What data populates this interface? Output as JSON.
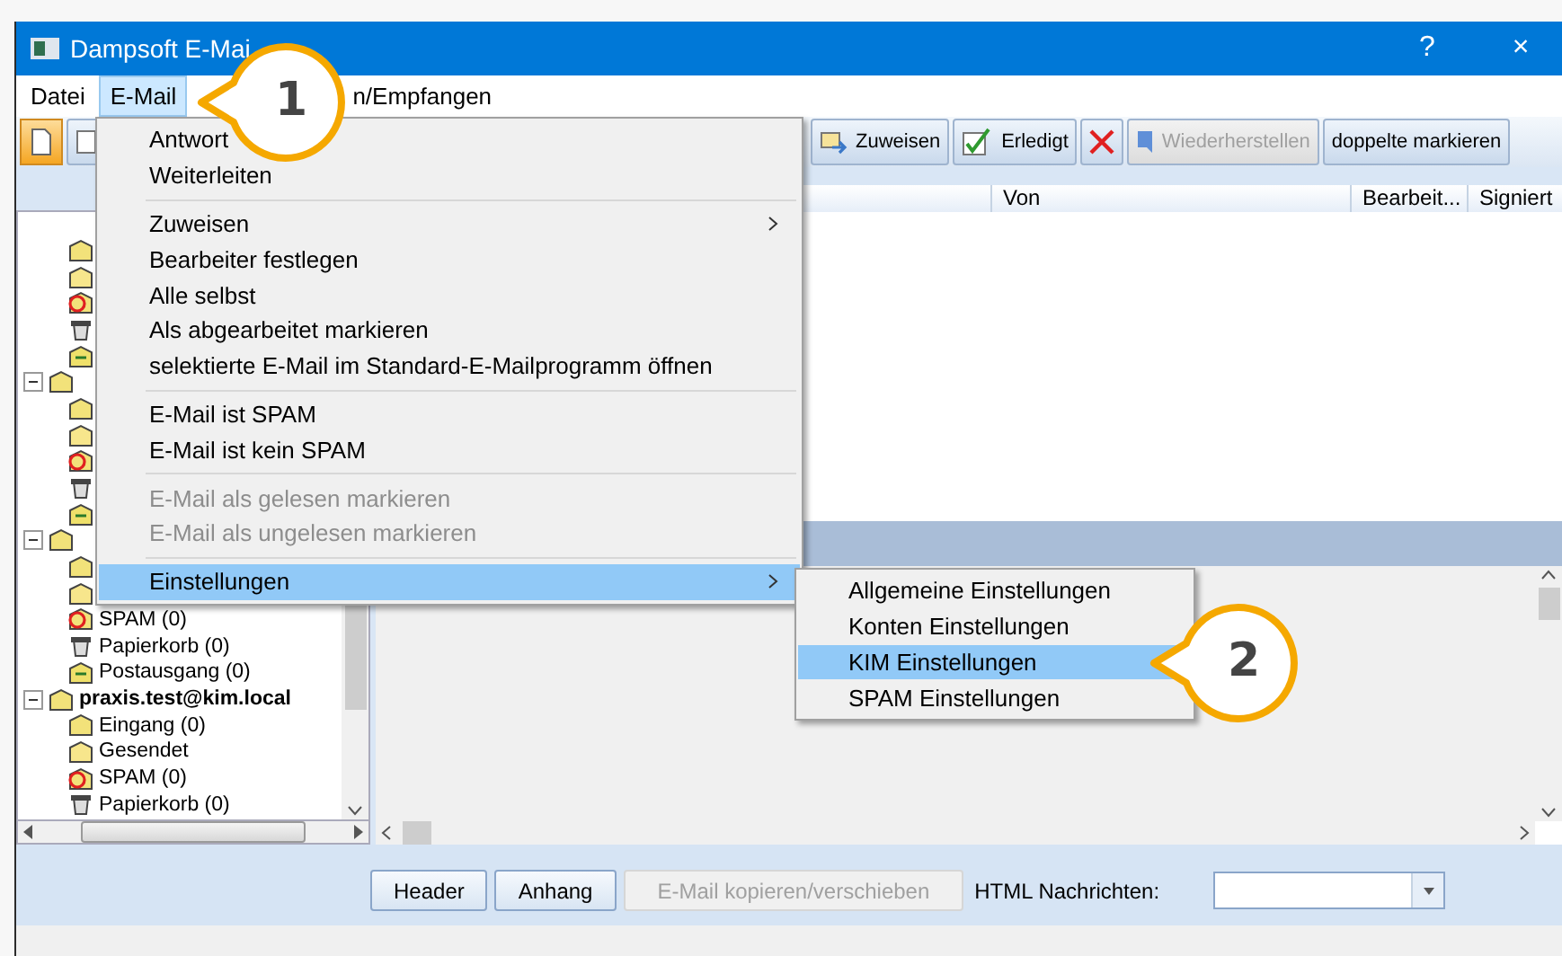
{
  "window": {
    "title": "Dampsoft E-Mai",
    "controls": [
      "?",
      "×"
    ]
  },
  "menu_bar": [
    {
      "label": "Datei",
      "selected": false
    },
    {
      "label": "E-Mail",
      "selected": true
    },
    {
      "label": "n/Empfangen",
      "selected": false
    }
  ],
  "toolbar": {
    "buttons": [
      {
        "kind": "assign",
        "label": "Zuweisen",
        "disabled": false
      },
      {
        "kind": "check",
        "label": "Erledigt",
        "disabled": false
      },
      {
        "kind": "delete",
        "disabled": false
      },
      {
        "kind": "restore",
        "label": "Wiederherstellen",
        "disabled": true
      },
      {
        "kind": "text",
        "label": "doppelte markieren",
        "disabled": false
      }
    ]
  },
  "columns": [
    {
      "label": "Von"
    },
    {
      "label": "Bearbeit..."
    },
    {
      "label": "Signiert"
    }
  ],
  "tree": [
    {
      "kind": "inbox"
    },
    {
      "kind": "sent"
    },
    {
      "kind": "spam"
    },
    {
      "kind": "trash"
    },
    {
      "kind": "outbox"
    },
    {
      "kind": "account",
      "expanded": true,
      "children": [
        {
          "kind": "inbox"
        },
        {
          "kind": "sent"
        },
        {
          "kind": "spam"
        },
        {
          "kind": "trash"
        },
        {
          "kind": "outbox"
        }
      ]
    },
    {
      "kind": "account",
      "expanded": true,
      "children": [
        {
          "kind": "inbox"
        },
        {
          "kind": "sent"
        },
        {
          "kind": "spam",
          "label": "SPAM (0)"
        },
        {
          "kind": "trash",
          "label": "Papierkorb (0)"
        },
        {
          "kind": "outbox",
          "label": "Postausgang (0)"
        }
      ]
    },
    {
      "kind": "account",
      "label": "praxis.test@kim.local",
      "expanded": true,
      "children": [
        {
          "kind": "inbox",
          "label": "Eingang (0)"
        },
        {
          "kind": "sent",
          "label": "Gesendet"
        },
        {
          "kind": "spam",
          "label": "SPAM (0)"
        },
        {
          "kind": "trash",
          "label": "Papierkorb (0)"
        }
      ]
    }
  ],
  "email_menu": [
    {
      "kind": "item",
      "label": "Antwort",
      "disabled": false,
      "selected": false
    },
    {
      "kind": "item",
      "label": "Weiterleiten",
      "disabled": false,
      "selected": false
    },
    {
      "kind": "separator"
    },
    {
      "kind": "submenu",
      "label": "Zuweisen",
      "disabled": false,
      "selected": false
    },
    {
      "kind": "item",
      "label": "Bearbeiter festlegen",
      "disabled": false,
      "selected": false
    },
    {
      "kind": "item",
      "label": "Alle selbst",
      "disabled": false,
      "selected": false
    },
    {
      "kind": "item",
      "label": "Als abgearbeitet markieren",
      "disabled": false,
      "selected": false
    },
    {
      "kind": "item",
      "label": "selektierte E-Mail im Standard-E-Mailprogramm öffnen",
      "disabled": false,
      "selected": false
    },
    {
      "kind": "separator"
    },
    {
      "kind": "item",
      "label": "E-Mail ist SPAM",
      "disabled": false,
      "selected": false
    },
    {
      "kind": "item",
      "label": "E-Mail ist kein SPAM",
      "disabled": false,
      "selected": false
    },
    {
      "kind": "separator"
    },
    {
      "kind": "item",
      "label": "E-Mail als gelesen markieren",
      "disabled": true,
      "selected": false
    },
    {
      "kind": "item",
      "label": "E-Mail als ungelesen markieren",
      "disabled": true,
      "selected": false
    },
    {
      "kind": "separator"
    },
    {
      "kind": "submenu",
      "label": "Einstellungen",
      "disabled": false,
      "selected": true
    }
  ],
  "settings_submenu": [
    {
      "label": "Allgemeine Einstellungen",
      "selected": false
    },
    {
      "label": "Konten Einstellungen",
      "selected": false
    },
    {
      "label": "KIM Einstellungen",
      "selected": true
    },
    {
      "label": "SPAM Einstellungen",
      "selected": false
    }
  ],
  "bottom_bar": {
    "buttons": [
      {
        "label": "Header",
        "disabled": false
      },
      {
        "label": "Anhang",
        "disabled": false
      },
      {
        "label": "E-Mail kopieren/verschieben",
        "disabled": true
      }
    ],
    "html_label": "HTML Nachrichten:"
  },
  "callouts": [
    {
      "number": "1"
    },
    {
      "number": "2"
    }
  ]
}
